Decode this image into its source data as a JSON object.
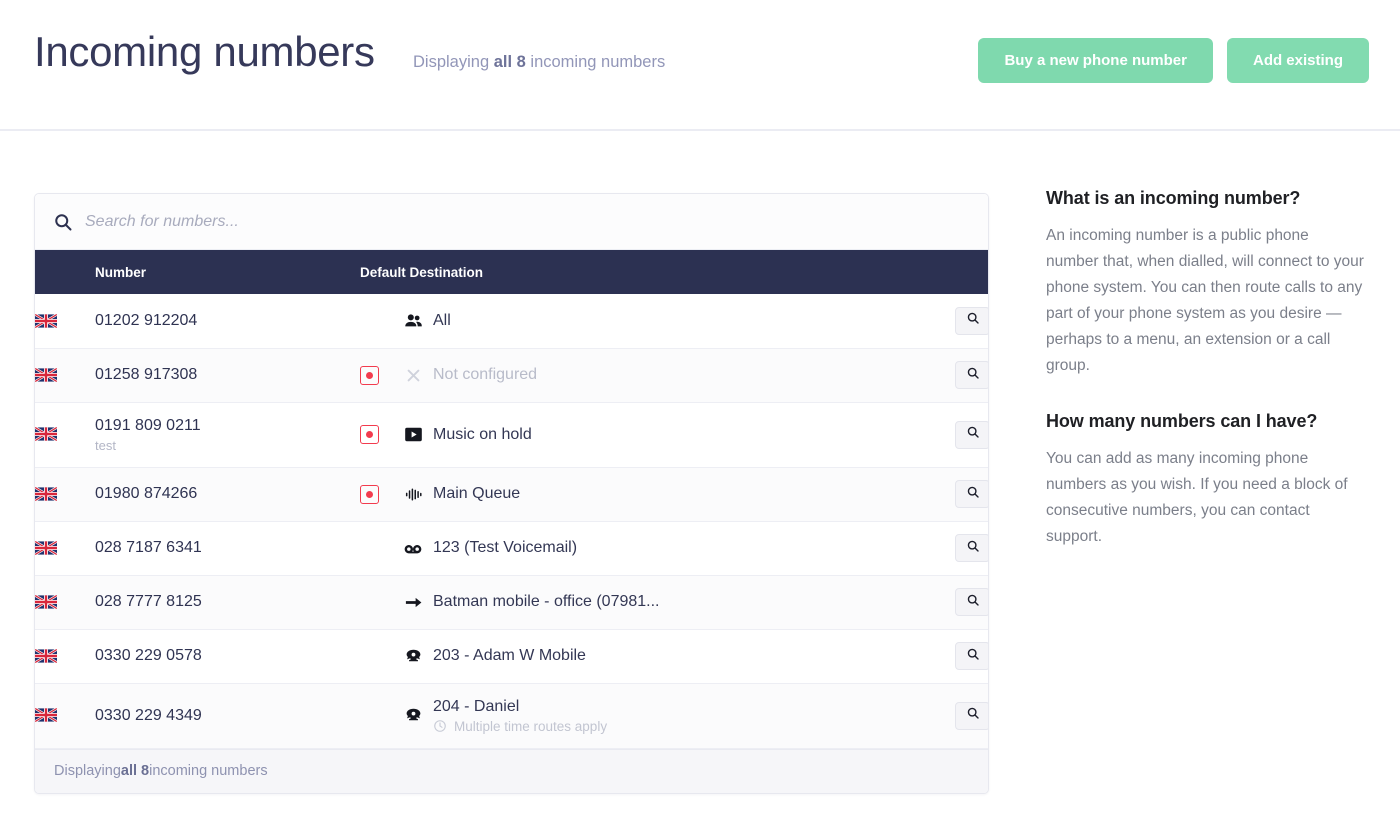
{
  "header": {
    "title": "Incoming numbers",
    "subtitle_prefix": "Displaying ",
    "subtitle_strong": "all 8",
    "subtitle_suffix": " incoming numbers",
    "buy_button": "Buy a new phone number",
    "add_button": "Add existing",
    "accent_green": "#7fd9ae",
    "title_color": "#36395a"
  },
  "search": {
    "placeholder": "Search for numbers...",
    "value": "",
    "icon": "search-icon"
  },
  "table": {
    "columns": [
      "Number",
      "Default Destination"
    ],
    "header_bg": "#2c3152",
    "rows": [
      {
        "flag": "uk-flag",
        "number": "01202 912204",
        "number_sub": "",
        "recording": false,
        "dest_icon": "users-group-icon",
        "dest_label": "All",
        "dest_muted": false,
        "dest_sub": "",
        "dest_sub_icon": "",
        "action": "magnifier-icon"
      },
      {
        "flag": "uk-flag",
        "number": "01258 917308",
        "number_sub": "",
        "recording": true,
        "dest_icon": "x-cross-icon",
        "dest_label": "Not configured",
        "dest_muted": true,
        "dest_sub": "",
        "dest_sub_icon": "",
        "action": "magnifier-icon"
      },
      {
        "flag": "uk-flag",
        "number": "0191 809 0211",
        "number_sub": "test",
        "recording": true,
        "dest_icon": "play-music-icon",
        "dest_label": "Music on hold",
        "dest_muted": false,
        "dest_sub": "",
        "dest_sub_icon": "",
        "action": "magnifier-icon"
      },
      {
        "flag": "uk-flag",
        "number": "01980 874266",
        "number_sub": "",
        "recording": true,
        "dest_icon": "queue-bars-icon",
        "dest_label": "Main Queue",
        "dest_muted": false,
        "dest_sub": "",
        "dest_sub_icon": "",
        "action": "magnifier-icon"
      },
      {
        "flag": "uk-flag",
        "number": "028 7187 6341",
        "number_sub": "",
        "recording": false,
        "dest_icon": "voicemail-tape-icon",
        "dest_label": "123 (Test Voicemail)",
        "dest_muted": false,
        "dest_sub": "",
        "dest_sub_icon": "",
        "action": "magnifier-icon"
      },
      {
        "flag": "uk-flag",
        "number": "028 7777 8125",
        "number_sub": "",
        "recording": false,
        "dest_icon": "arrow-right-icon",
        "dest_label": "Batman mobile - office (07981...",
        "dest_muted": false,
        "dest_sub": "",
        "dest_sub_icon": "",
        "action": "magnifier-icon"
      },
      {
        "flag": "uk-flag",
        "number": "0330 229 0578",
        "number_sub": "",
        "recording": false,
        "dest_icon": "telephone-icon",
        "dest_label": "203 - Adam W Mobile",
        "dest_muted": false,
        "dest_sub": "",
        "dest_sub_icon": "",
        "action": "magnifier-icon"
      },
      {
        "flag": "uk-flag",
        "number": "0330 229 4349",
        "number_sub": "",
        "recording": false,
        "dest_icon": "telephone-icon",
        "dest_label": "204 - Daniel",
        "dest_muted": false,
        "dest_sub": "Multiple time routes apply",
        "dest_sub_icon": "clock-icon",
        "action": "magnifier-icon"
      }
    ],
    "footer_prefix": "Displaying ",
    "footer_strong": "all 8",
    "footer_suffix": " incoming numbers"
  },
  "help": {
    "q1_title": "What is an incoming number?",
    "q1_body": "An incoming number is a public phone number that, when dialled, will connect to your phone system. You can then route calls to any part of your phone system as you desire — perhaps to a menu, an extension or a call group.",
    "q2_title": "How many numbers can I have?",
    "q2_body": "You can add as many incoming phone numbers as you wish. If you need a block of consecutive numbers, you can contact support."
  }
}
